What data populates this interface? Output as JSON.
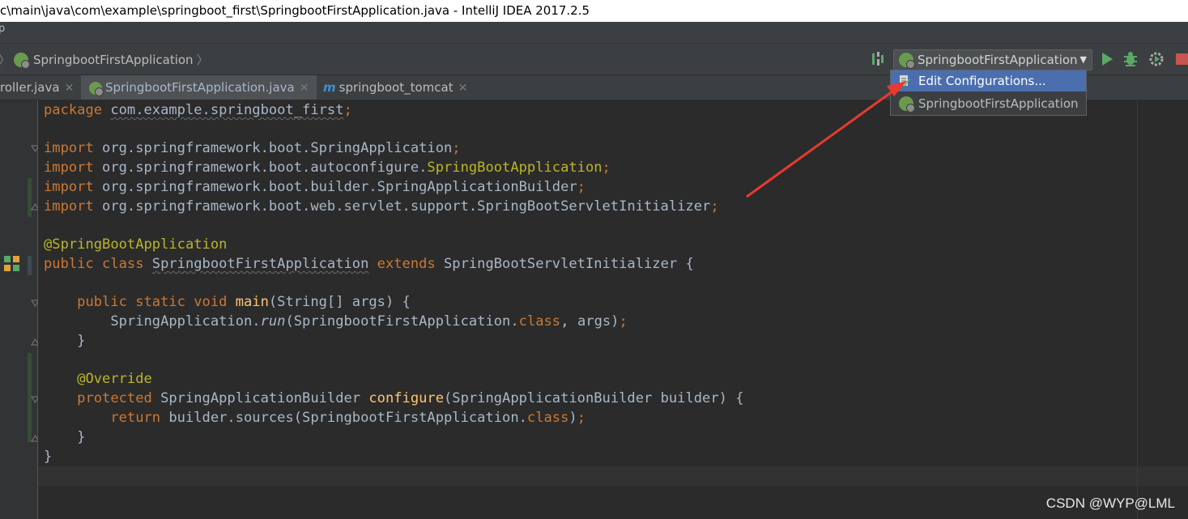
{
  "window": {
    "title": "c\\main\\java\\com\\example\\springboot_first\\SpringbootFirstApplication.java - IntelliJ IDEA 2017.2.5"
  },
  "menubar": {
    "partial_label": "p"
  },
  "breadcrumb": {
    "item": "SpringbootFirstApplication"
  },
  "run_config": {
    "selected": "SpringbootFirstApplication",
    "menu": [
      {
        "label": "Edit Configurations...",
        "icon": "edit-config-icon",
        "highlighted": true
      },
      {
        "label": "SpringbootFirstApplication",
        "icon": "spring-boot-icon",
        "highlighted": false
      }
    ]
  },
  "tabs": [
    {
      "label": "roller.java",
      "active": false
    },
    {
      "label": "SpringbootFirstApplication.java",
      "active": true
    },
    {
      "label": "springboot_tomcat",
      "active": false
    }
  ],
  "code_lines": [
    "package com.example.springboot_first;",
    "",
    "import org.springframework.boot.SpringApplication;",
    "import org.springframework.boot.autoconfigure.SpringBootApplication;",
    "import org.springframework.boot.builder.SpringApplicationBuilder;",
    "import org.springframework.boot.web.servlet.support.SpringBootServletInitializer;",
    "",
    "@SpringBootApplication",
    "public class SpringbootFirstApplication extends SpringBootServletInitializer {",
    "",
    "    public static void main(String[] args) {",
    "        SpringApplication.run(SpringbootFirstApplication.class, args);",
    "    }",
    "",
    "    @Override",
    "    protected SpringApplicationBuilder configure(SpringApplicationBuilder builder) {",
    "        return builder.sources(SpringbootFirstApplication.class);",
    "    }",
    "}"
  ],
  "code": {
    "pkg_kw": "package",
    "pkg_name": "com.example.springboot_first",
    "semi": ";",
    "import_kw": "import",
    "imp1": " org.springframework.boot.SpringApplication",
    "imp2_a": " org.springframework.boot.autoconfigure.",
    "imp2_b": "SpringBootApplication",
    "imp3": " org.springframework.boot.builder.SpringApplicationBuilder",
    "imp4": " org.springframework.boot.web.servlet.support.SpringBootServletInitializer",
    "anno1": "@SpringBootApplication",
    "public_class": "public class ",
    "class_name": "SpringbootFirstApplication",
    "extends": " extends ",
    "parent": "SpringBootServletInitializer {",
    "main_mods": "public static void ",
    "main_name": "main",
    "main_sig": "(String[] args) {",
    "run_a": "SpringApplication.",
    "run_b": "run",
    "run_c": "(SpringbootFirstApplication.",
    "class_kw": "class",
    "run_d": ", args)",
    "close_brace": "}",
    "anno2": "@Override",
    "protected": "protected ",
    "cfg_type": "SpringApplicationBuilder ",
    "cfg_name": "configure",
    "cfg_sig": "(SpringApplicationBuilder builder) {",
    "return_kw": "return ",
    "ret_a": "builder.sources(SpringbootFirstApplication.",
    "ret_b": ")"
  },
  "watermark": "CSDN @WYP@LML",
  "colors": {
    "editor_bg": "#2b2b2b",
    "keyword": "#cc7832",
    "annotation": "#bbb529",
    "method": "#ffc66d",
    "text": "#a9b7c6",
    "selection": "#4b6eaf",
    "arrow": "#e83a2f",
    "run_green": "#59a869"
  }
}
